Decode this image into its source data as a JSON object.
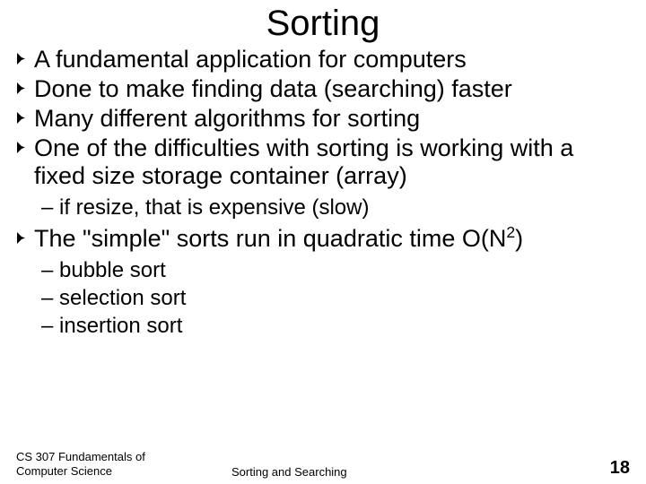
{
  "title": "Sorting",
  "bullets": {
    "b0": "A fundamental application for computers",
    "b1": "Done to make finding data (searching) faster",
    "b2": "Many different algorithms for sorting",
    "b3": "One of the difficulties with sorting is working with a fixed size storage container (array)",
    "b4_pre": "The \"simple\" sorts run in quadratic time O(N",
    "b4_sup": "2",
    "b4_post": ")"
  },
  "subs": {
    "s0": "– if resize, that is expensive (slow)",
    "s1": "– bubble sort",
    "s2": "– selection sort",
    "s3": "– insertion sort"
  },
  "footer": {
    "left_line1": "CS 307 Fundamentals of",
    "left_line2": "Computer Science",
    "center": "Sorting and Searching",
    "page": "18"
  }
}
